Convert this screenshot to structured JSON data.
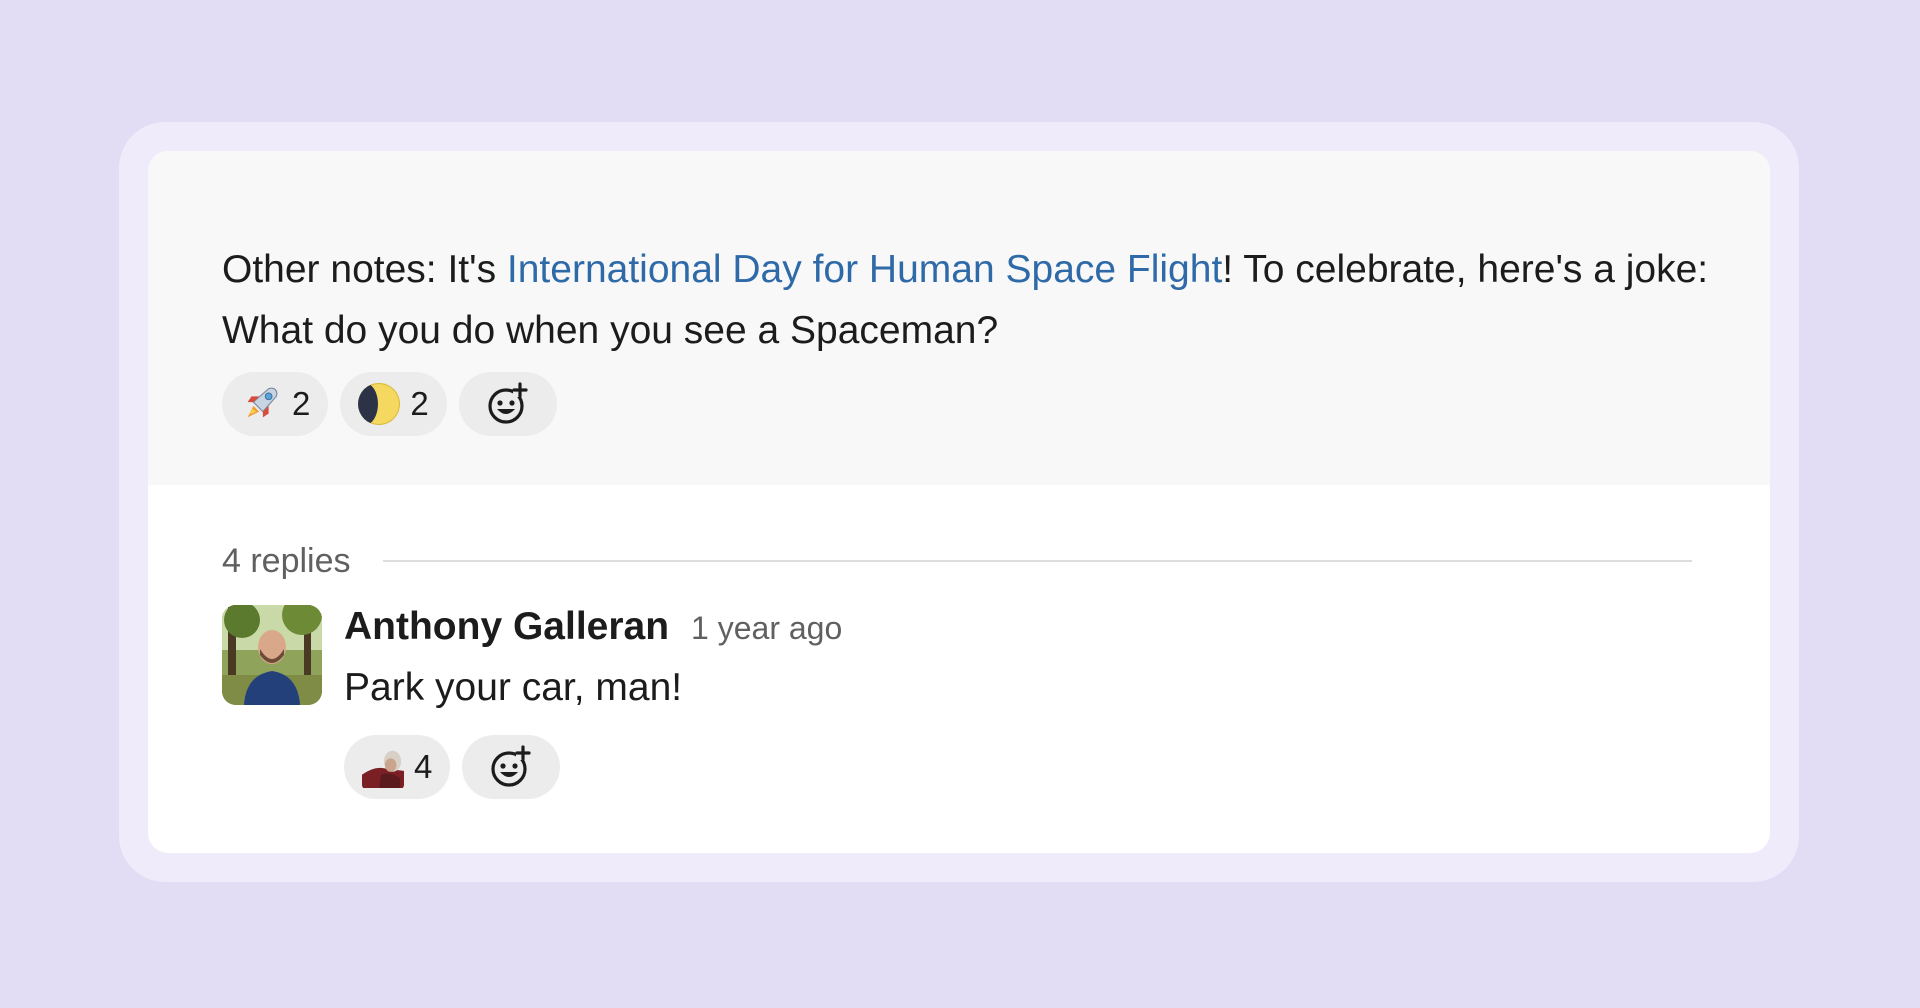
{
  "thread": {
    "parent_message": {
      "text_before_link": "Other notes: It's ",
      "link_text": "International Day for Human Space Flight",
      "text_after_link": "! To celebrate, here's a joke: What do you do when you see a Spaceman?",
      "reactions": [
        {
          "icon": "rocket-emoji",
          "count": "2"
        },
        {
          "icon": "moon-emoji",
          "count": "2"
        }
      ],
      "add_reaction_icon": "add-reaction-icon"
    },
    "replies_count_label": "4 replies",
    "reply": {
      "author": "Anthony Galleran",
      "timestamp": "1 year ago",
      "text": "Park your car, man!",
      "reactions": [
        {
          "icon": "custom-person-emoji",
          "count": "4"
        }
      ],
      "add_reaction_icon": "add-reaction-icon"
    }
  },
  "colors": {
    "background": "#e2dcf5",
    "link": "#2f6aa8",
    "reaction_pill": "#ececec"
  }
}
